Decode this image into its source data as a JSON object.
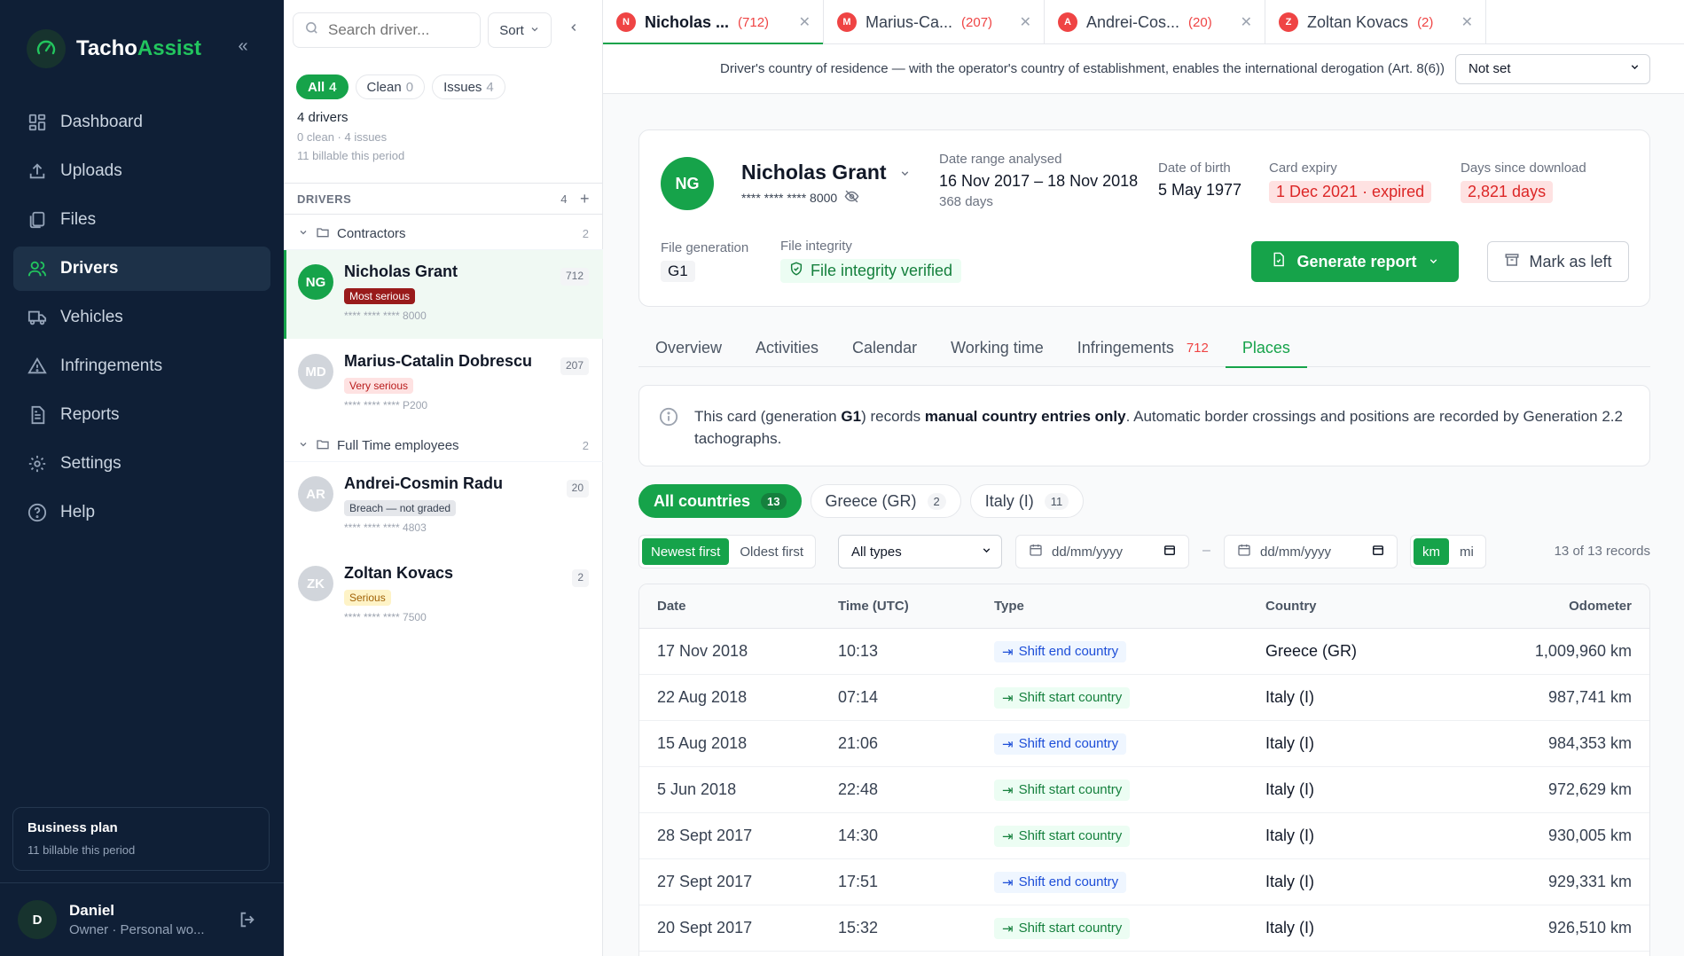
{
  "app": {
    "brand_main": "Tacho",
    "brand_accent": "Assist",
    "accent_color": "#16a34a"
  },
  "sidebar": {
    "items": [
      {
        "label": "Dashboard",
        "icon": "dashboard-icon"
      },
      {
        "label": "Uploads",
        "icon": "upload-icon"
      },
      {
        "label": "Files",
        "icon": "files-icon"
      },
      {
        "label": "Drivers",
        "icon": "drivers-icon"
      },
      {
        "label": "Vehicles",
        "icon": "truck-icon"
      },
      {
        "label": "Infringements",
        "icon": "warning-icon"
      },
      {
        "label": "Reports",
        "icon": "report-icon"
      },
      {
        "label": "Settings",
        "icon": "gear-icon"
      },
      {
        "label": "Help",
        "icon": "help-icon"
      }
    ],
    "plan": {
      "title": "Business plan",
      "sub": "11 billable this period"
    },
    "user": {
      "initial": "D",
      "name": "Daniel",
      "role": "Owner · Personal wo..."
    }
  },
  "drivers_panel": {
    "search_placeholder": "Search driver...",
    "sort_label": "Sort",
    "filters": [
      {
        "label": "All",
        "count": "4"
      },
      {
        "label": "Clean",
        "count": "0"
      },
      {
        "label": "Issues",
        "count": "4"
      }
    ],
    "summary": {
      "line1": "4 drivers",
      "line2": "0 clean · 4 issues",
      "line3": "11 billable this period"
    },
    "section_label": "DRIVERS",
    "section_count": "4",
    "groups": [
      {
        "name": "Contractors",
        "count": "2"
      },
      {
        "name": "Full Time employees",
        "count": "2"
      }
    ],
    "drivers": [
      {
        "initials": "NG",
        "name": "Nicholas Grant",
        "badge": "Most serious",
        "card": "**** **** **** 8000",
        "count": "712"
      },
      {
        "initials": "MD",
        "name": "Marius-Catalin Dobrescu",
        "badge": "Very serious",
        "card": "**** **** **** P200",
        "count": "207"
      },
      {
        "initials": "AR",
        "name": "Andrei-Cosmin Radu",
        "badge": "Breach — not graded",
        "card": "**** **** **** 4803",
        "count": "20"
      },
      {
        "initials": "ZK",
        "name": "Zoltan Kovacs",
        "badge": "Serious",
        "card": "**** **** **** 7500",
        "count": "2"
      }
    ]
  },
  "tabs": [
    {
      "initial": "N",
      "name": "Nicholas ...",
      "count": "(712)"
    },
    {
      "initial": "M",
      "name": "Marius-Ca...",
      "count": "(207)"
    },
    {
      "initial": "A",
      "name": "Andrei-Cos...",
      "count": "(20)"
    },
    {
      "initial": "Z",
      "name": "Zoltan Kovacs",
      "count": "(2)"
    }
  ],
  "residence": {
    "label": "Driver's country of residence — with the operator's country of establishment, enables the international derogation (Art. 8(6))",
    "value": "Not set"
  },
  "profile": {
    "initials": "NG",
    "name": "Nicholas Grant",
    "card": "**** **** **** 8000",
    "range_label": "Date range analysed",
    "range_value": "16 Nov 2017 – 18 Nov 2018",
    "range_days": "368 days",
    "dob_label": "Date of birth",
    "dob_value": "5 May 1977",
    "expiry_label": "Card expiry",
    "expiry_value": "1 Dec 2021 · expired",
    "download_label": "Days since download",
    "download_value": "2,821 days",
    "gen_label": "File generation",
    "gen_value": "G1",
    "integrity_label": "File integrity",
    "integrity_value": "File integrity verified",
    "generate_btn": "Generate report",
    "left_btn": "Mark as left"
  },
  "section_tabs": [
    {
      "label": "Overview",
      "badge": ""
    },
    {
      "label": "Activities",
      "badge": ""
    },
    {
      "label": "Calendar",
      "badge": ""
    },
    {
      "label": "Working time",
      "badge": ""
    },
    {
      "label": "Infringements",
      "badge": "712"
    },
    {
      "label": "Places",
      "badge": ""
    }
  ],
  "info": {
    "part1": "This card (generation ",
    "gen": "G1",
    "part2": ") records ",
    "bold": "manual country entries only",
    "part3": ". Automatic border crossings and positions are recorded by Generation 2.2 tachographs."
  },
  "countries": [
    {
      "label": "All countries",
      "count": "13"
    },
    {
      "label": "Greece (GR)",
      "count": "2"
    },
    {
      "label": "Italy (I)",
      "count": "11"
    }
  ],
  "controls": {
    "newest": "Newest first",
    "oldest": "Oldest first",
    "type_value": "All types",
    "date_placeholder": "dd/mm/yyyy",
    "dash": "–",
    "km": "km",
    "mi": "mi",
    "record_count": "13 of 13 records"
  },
  "table": {
    "headers": {
      "date": "Date",
      "time": "Time (UTC)",
      "type": "Type",
      "country": "Country",
      "odometer": "Odometer"
    },
    "rows": [
      {
        "date": "17 Nov 2018",
        "time": "10:13",
        "type": "Shift end country",
        "kind": "end",
        "country": "Greece (GR)",
        "odometer": "1,009,960 km"
      },
      {
        "date": "22 Aug 2018",
        "time": "07:14",
        "type": "Shift start country",
        "kind": "start",
        "country": "Italy (I)",
        "odometer": "987,741 km"
      },
      {
        "date": "15 Aug 2018",
        "time": "21:06",
        "type": "Shift end country",
        "kind": "end",
        "country": "Italy (I)",
        "odometer": "984,353 km"
      },
      {
        "date": "5 Jun 2018",
        "time": "22:48",
        "type": "Shift start country",
        "kind": "start",
        "country": "Italy (I)",
        "odometer": "972,629 km"
      },
      {
        "date": "28 Sept 2017",
        "time": "14:30",
        "type": "Shift start country",
        "kind": "start",
        "country": "Italy (I)",
        "odometer": "930,005 km"
      },
      {
        "date": "27 Sept 2017",
        "time": "17:51",
        "type": "Shift end country",
        "kind": "end",
        "country": "Italy (I)",
        "odometer": "929,331 km"
      },
      {
        "date": "20 Sept 2017",
        "time": "15:32",
        "type": "Shift start country",
        "kind": "start",
        "country": "Italy (I)",
        "odometer": "926,510 km"
      }
    ]
  }
}
